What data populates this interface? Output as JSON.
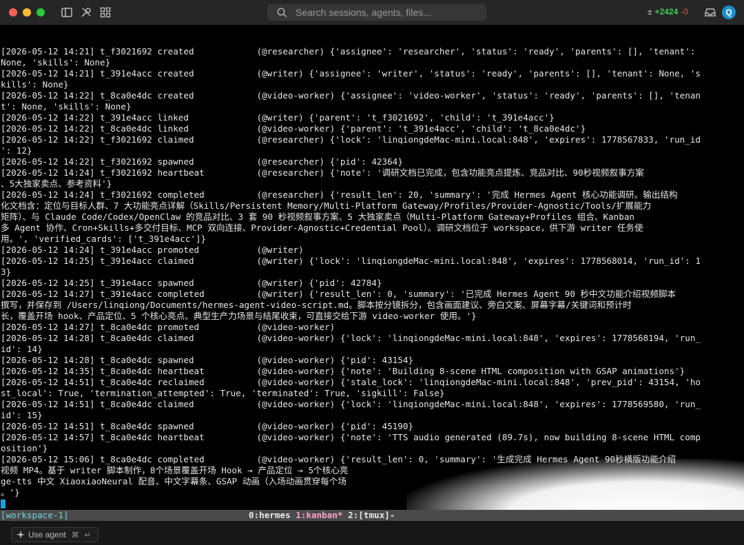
{
  "titlebar": {
    "search_placeholder": "Search sessions, agents, files...",
    "diff_symbol": "±",
    "additions": "+2424",
    "deletions": "-0",
    "avatar_initial": "Q"
  },
  "terminal": {
    "lines": [
      "[2026-05-12 14:21] t_f3021692 created            (@researcher) {'assignee': 'researcher', 'status': 'ready', 'parents': [], 'tenant':",
      "None, 'skills': None}",
      "[2026-05-12 14:21] t_391e4acc created            (@writer) {'assignee': 'writer', 'status': 'ready', 'parents': [], 'tenant': None, 's",
      "kills': None}",
      "[2026-05-12 14:22] t_8ca0e4dc created            (@video-worker) {'assignee': 'video-worker', 'status': 'ready', 'parents': [], 'tenan",
      "t': None, 'skills': None}",
      "[2026-05-12 14:22] t_391e4acc linked             (@writer) {'parent': 't_f3021692', 'child': 't_391e4acc'}",
      "[2026-05-12 14:22] t_8ca0e4dc linked             (@video-worker) {'parent': 't_391e4acc', 'child': 't_8ca0e4dc'}",
      "[2026-05-12 14:22] t_f3021692 claimed            (@researcher) {'lock': 'linqiongdeMac-mini.local:848', 'expires': 1778567833, 'run_id",
      "': 12}",
      "[2026-05-12 14:22] t_f3021692 spawned            (@researcher) {'pid': 42364}",
      "[2026-05-12 14:24] t_f3021692 heartbeat          (@researcher) {'note': '调研文档已完成，包含功能亮点提炼、竞品对比、90秒视频叙事方案",
      "、5大独家卖点、参考资料'}",
      "[2026-05-12 14:24] t_f3021692 completed          (@researcher) {'result_len': 20, 'summary': '完成 Hermes Agent 核心功能调研。输出结构",
      "化文档含：定位与目标人群、7 大功能亮点详解（Skills/Persistent Memory/Multi-Platform Gateway/Profiles/Provider-Agnostic/Tools/扩展能力",
      "矩阵）、与 Claude Code/Codex/OpenClaw 的竞品对比、3 套 90 秒视频叙事方案、5 大独家卖点（Multi-Platform Gateway+Profiles 组合、Kanban",
      "多 Agent 协作、Cron+Skills+多交付目标、MCP 双向连接、Provider-Agnostic+Credential Pool）。调研文档位于 workspace，供下游 writer 任务使",
      "用。', 'verified_cards': ['t_391e4acc']}",
      "[2026-05-12 14:24] t_391e4acc promoted           (@writer)",
      "[2026-05-12 14:25] t_391e4acc claimed            (@writer) {'lock': 'linqiongdeMac-mini.local:848', 'expires': 1778568014, 'run_id': 1",
      "3}",
      "[2026-05-12 14:25] t_391e4acc spawned            (@writer) {'pid': 42784}",
      "[2026-05-12 14:27] t_391e4acc completed          (@writer) {'result_len': 0, 'summary': '已完成 Hermes Agent 90 秒中文功能介绍视频脚本",
      "撰写，并保存到 /Users/linqiong/Documents/hermes-agent-video-script.md。脚本按分镜拆分，包含画面建议、旁白文案、屏幕字幕/关键词和预计时",
      "长，覆盖开场 hook、产品定位、5 个核心亮点、典型生产力场景与结尾收束，可直接交给下游 video-worker 使用。'}",
      "[2026-05-12 14:27] t_8ca0e4dc promoted           (@video-worker)",
      "[2026-05-12 14:28] t_8ca0e4dc claimed            (@video-worker) {'lock': 'linqiongdeMac-mini.local:848', 'expires': 1778568194, 'run_",
      "id': 14}",
      "[2026-05-12 14:28] t_8ca0e4dc spawned            (@video-worker) {'pid': 43154}",
      "[2026-05-12 14:35] t_8ca0e4dc heartbeat          (@video-worker) {'note': 'Building 8-scene HTML composition with GSAP animations'}",
      "[2026-05-12 14:51] t_8ca0e4dc reclaimed          (@video-worker) {'stale_lock': 'linqiongdeMac-mini.local:848', 'prev_pid': 43154, 'ho",
      "st_local': True, 'termination_attempted': True, 'terminated': True, 'sigkill': False}",
      "[2026-05-12 14:51] t_8ca0e4dc claimed            (@video-worker) {'lock': 'linqiongdeMac-mini.local:848', 'expires': 1778569580, 'run_",
      "id': 15}",
      "[2026-05-12 14:51] t_8ca0e4dc spawned            (@video-worker) {'pid': 45190}",
      "[2026-05-12 14:57] t_8ca0e4dc heartbeat          (@video-worker) {'note': 'TTS audio generated (89.7s), now building 8-scene HTML comp",
      "osition'}",
      "[2026-05-12 15:06] t_8ca0e4dc completed          (@video-worker) {'result_len': 0, 'summary': '生成完成 Hermes Agent 90秒横版功能介绍",
      "视频 MP4。基于 writer 脚本制作，8个场景覆盖开场 Hook → 产品定位 → 5个核心亮",
      "ge-tts 中文 XiaoxiaoNeural 配音、中文字幕条、GSAP 动画（入场动画贯穿每个场",
      "。'}"
    ]
  },
  "tmux": {
    "session": "[workspace-1]",
    "win0": "0:hermes",
    "win1": "1:kanban*",
    "win2": "2:[tmux]-"
  },
  "bottombar": {
    "use_agent_label": "Use agent",
    "shortcut": "⌘",
    "enter_glyph": "↵"
  }
}
